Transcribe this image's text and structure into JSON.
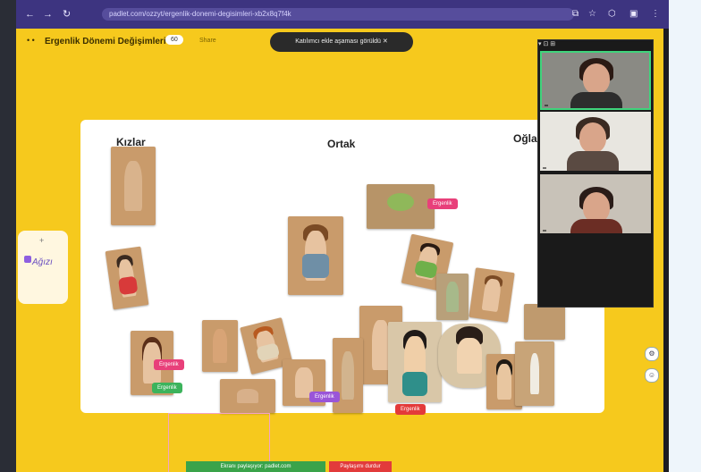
{
  "browser": {
    "nav": [
      "←",
      "→",
      "↻"
    ],
    "url": "padlet.com/ozzyt/ergenlik-donemi-degisimleri-xb2x8q7f4k",
    "icons": [
      "⧉",
      "☆",
      "⬡",
      "▣",
      "⋮"
    ]
  },
  "app": {
    "title": "Ergenlik Dönemi Değişimleri",
    "pill": "60",
    "share": "Share",
    "toast": "Katılımcı ekle aşaması görüldü ✕"
  },
  "board": {
    "columns": [
      "Kızlar",
      "Ortak",
      "Oğla"
    ],
    "tags": {
      "t1": "Ergenlik",
      "t2": "Ergenlik",
      "t3": "Ergenlik",
      "t4": "Ergenlik",
      "t5": "Ergenlik"
    }
  },
  "left_panel": {
    "plus": "+",
    "logo": "Ağızı"
  },
  "side_buttons": [
    "⚙",
    "☺"
  ],
  "video": {
    "top": "▾  ⊡  ⊞",
    "participants": [
      "",
      "",
      "",
      ""
    ]
  },
  "bottom": {
    "share_notice": "Ekranı paylaşıyor: padlet.com",
    "stop": "Paylaşımı durdur"
  },
  "colors": {
    "bg": "#f6c91d",
    "browser": "#3d3480",
    "tag_pink": "#e8407a",
    "tag_green": "#3cb35c"
  }
}
